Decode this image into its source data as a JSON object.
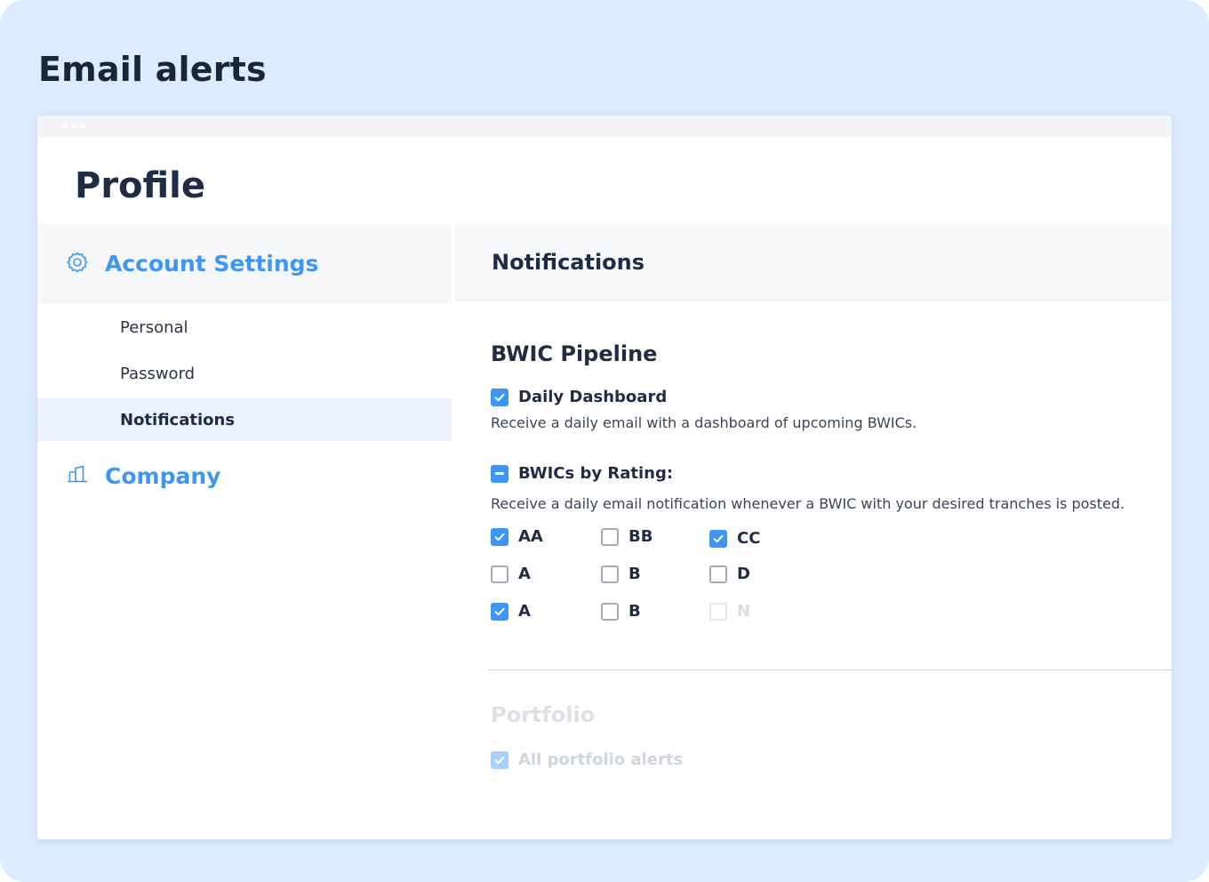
{
  "page_heading": "Email alerts",
  "profile_title": "Profile",
  "sidebar": {
    "account_settings": {
      "label": "Account Settings",
      "icon": "gear-icon"
    },
    "items": [
      {
        "label": "Personal",
        "active": false
      },
      {
        "label": "Password",
        "active": false
      },
      {
        "label": "Notifications",
        "active": true
      }
    ],
    "company": {
      "label": "Company",
      "icon": "building-icon"
    }
  },
  "main": {
    "header": "Notifications",
    "bwic_pipeline": {
      "title": "BWIC Pipeline",
      "daily_dashboard": {
        "label": "Daily Dashboard",
        "checked": true,
        "description": "Receive a daily email with a dashboard of upcoming BWICs."
      },
      "by_rating": {
        "label": "BWICs by Rating:",
        "state": "indeterminate",
        "description": "Receive a daily email notification whenever a BWIC with your desired tranches is posted.",
        "ratings": [
          {
            "label": "AA",
            "checked": true,
            "disabled": false
          },
          {
            "label": "BB",
            "checked": false,
            "disabled": false
          },
          {
            "label": "CC",
            "checked": true,
            "disabled": false
          },
          {
            "label": "A",
            "checked": false,
            "disabled": false
          },
          {
            "label": "B",
            "checked": false,
            "disabled": false
          },
          {
            "label": "D",
            "checked": false,
            "disabled": false
          },
          {
            "label": "A",
            "checked": true,
            "disabled": false
          },
          {
            "label": "B",
            "checked": false,
            "disabled": false
          },
          {
            "label": "N",
            "checked": false,
            "disabled": true
          }
        ]
      }
    },
    "portfolio": {
      "title": "Portfolio",
      "all_alerts": {
        "label": "All portfolio alerts",
        "checked": true,
        "disabled": true
      }
    }
  },
  "colors": {
    "accent": "#3d96f5",
    "background": "#dcebfd",
    "text": "#1f2c45",
    "active_row": "#ebf4fe"
  }
}
